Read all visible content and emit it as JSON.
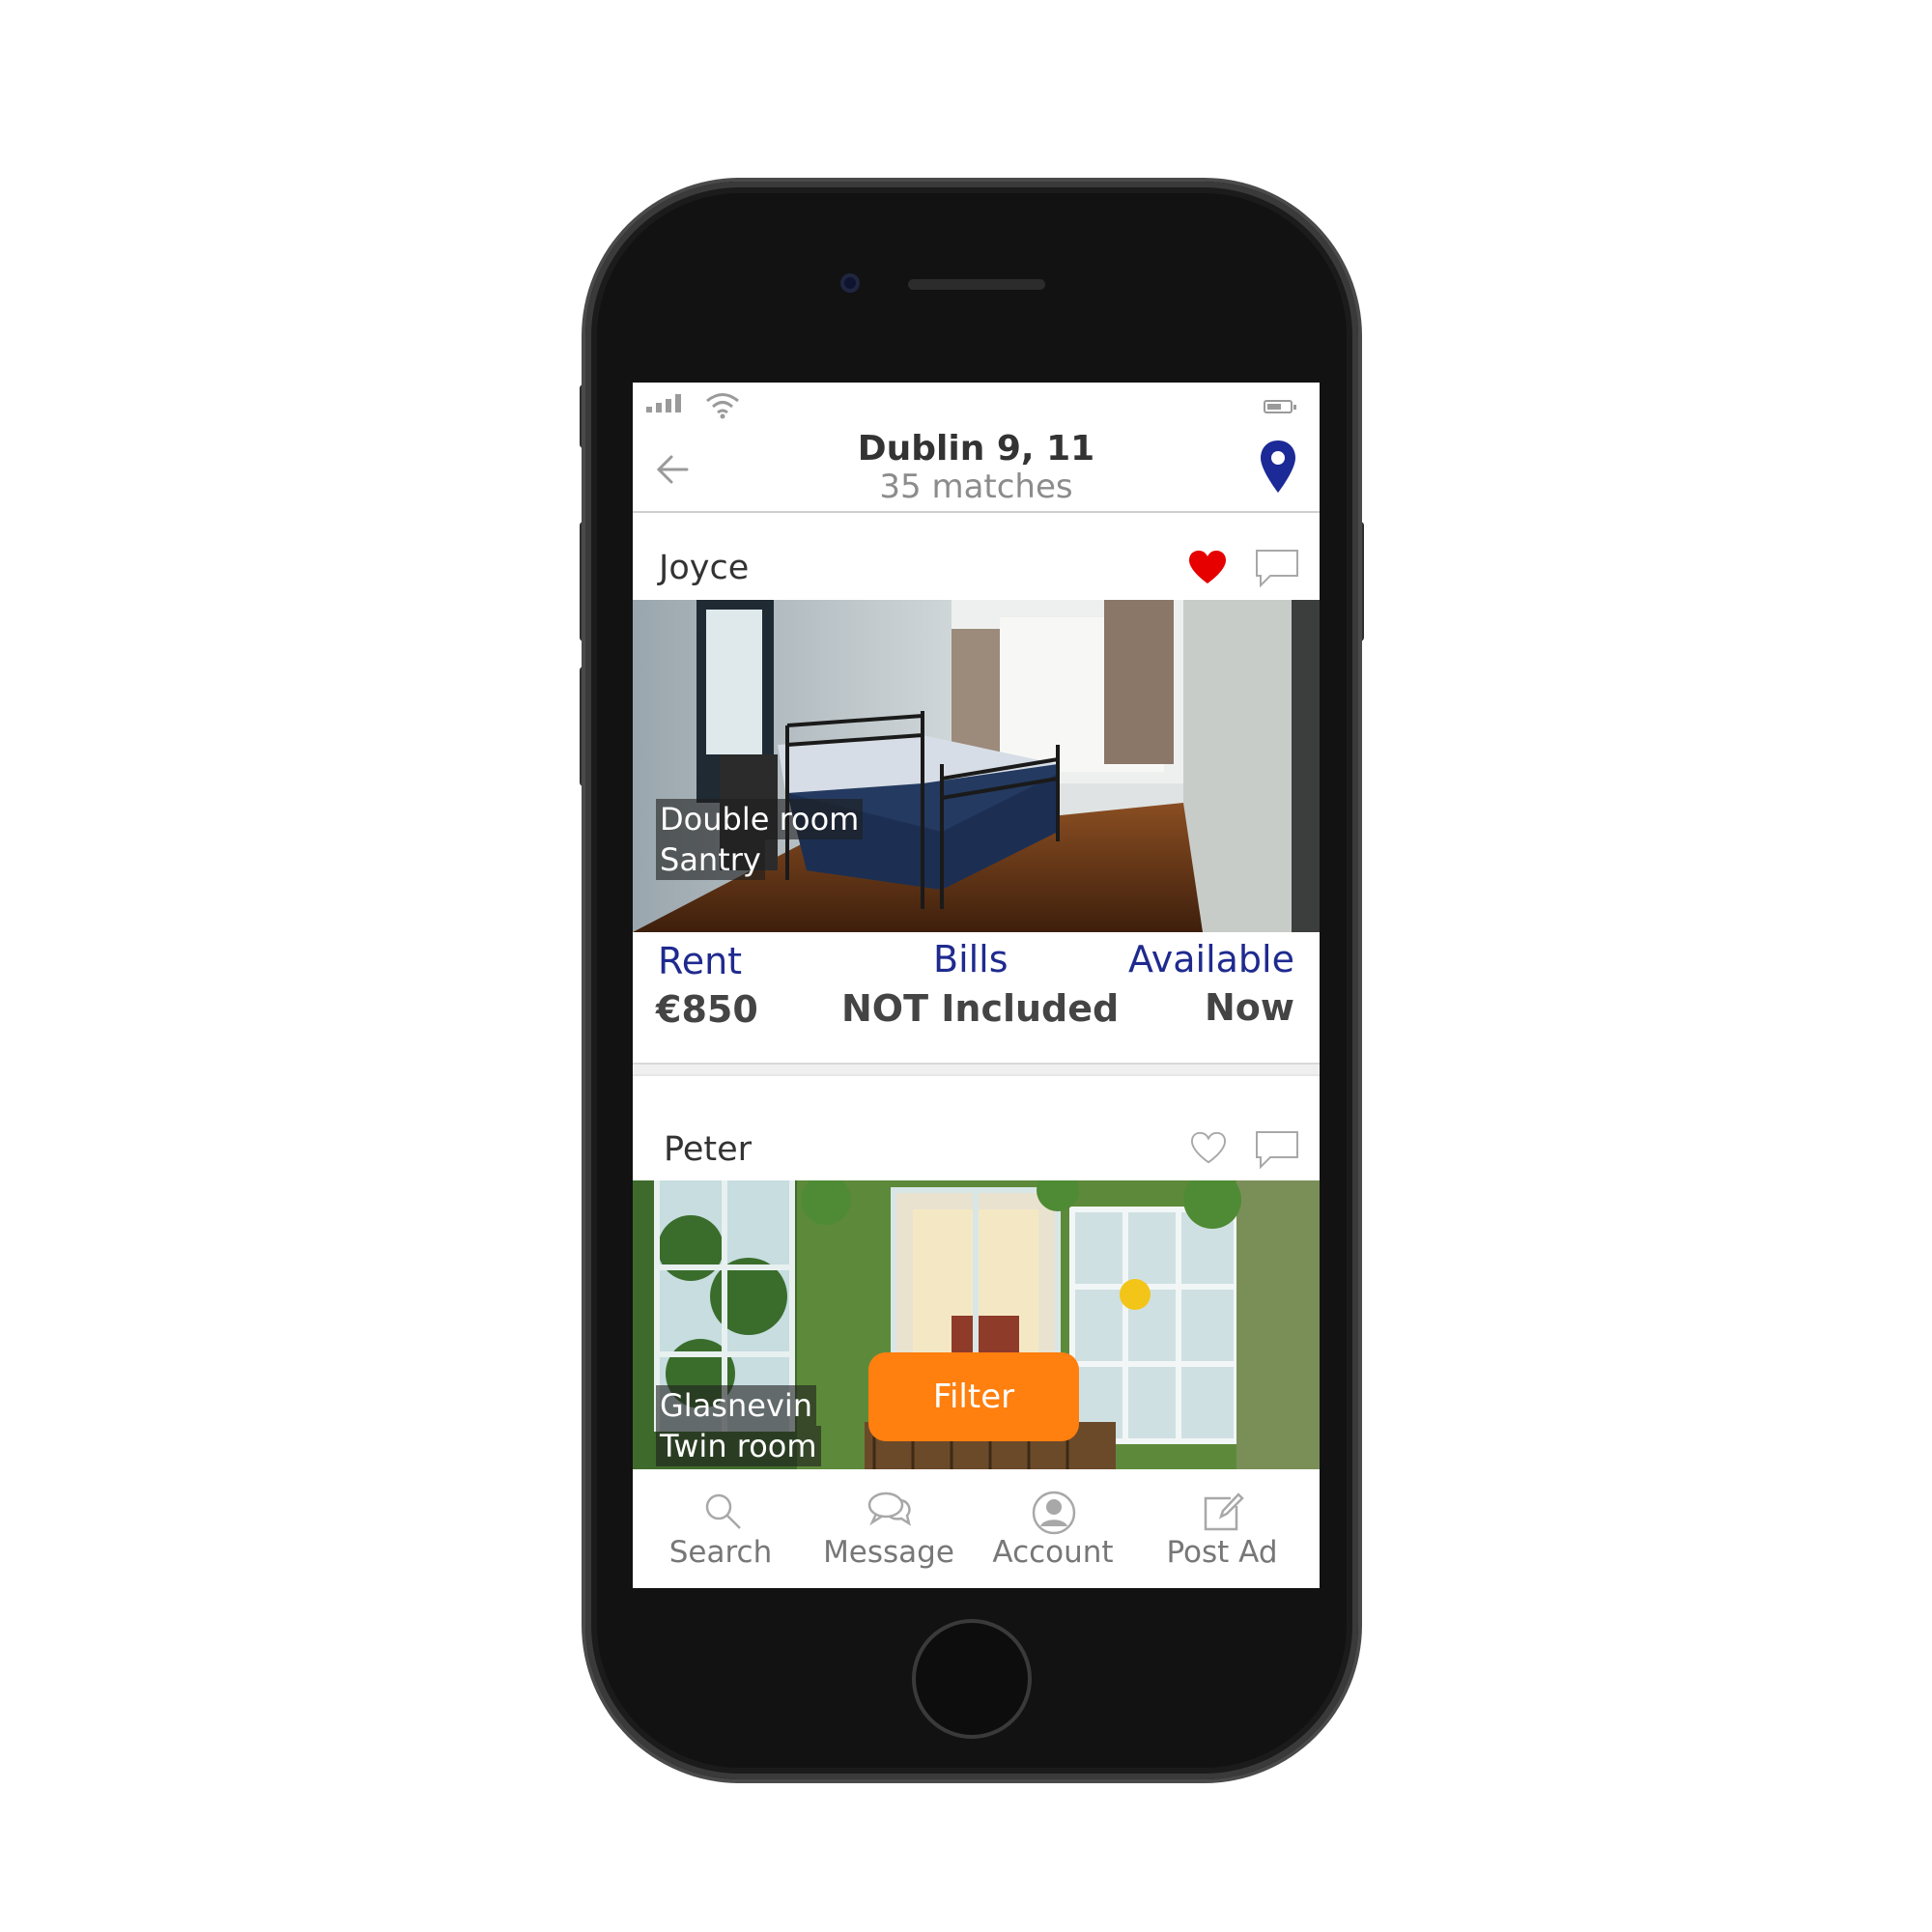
{
  "header": {
    "title": "Dublin 9, 11",
    "subtitle": "35 matches",
    "back_icon": "arrow-left-icon",
    "map_icon": "map-pin-icon"
  },
  "listings": [
    {
      "owner": "Joyce",
      "favorited": true,
      "photo_label_1": "Double room",
      "photo_label_2": "Santry",
      "rent_label": "Rent",
      "rent_value": "€850",
      "bills_label": "Bills",
      "bills_value": "NOT Included",
      "available_label": "Available",
      "available_value": "Now"
    },
    {
      "owner": "Peter",
      "favorited": false,
      "photo_label_1": "Glasnevin",
      "photo_label_2": "Twin room"
    }
  ],
  "filter_button": {
    "label": "Filter"
  },
  "nav": [
    {
      "label": "Search",
      "icon": "search-icon"
    },
    {
      "label": "Message",
      "icon": "message-icon"
    },
    {
      "label": "Account",
      "icon": "account-icon"
    },
    {
      "label": "Post Ad",
      "icon": "post-ad-icon"
    }
  ],
  "colors": {
    "accent_blue": "#1f2a8f",
    "favorite_red": "#e60000",
    "filter_orange": "#ff7f0f"
  }
}
